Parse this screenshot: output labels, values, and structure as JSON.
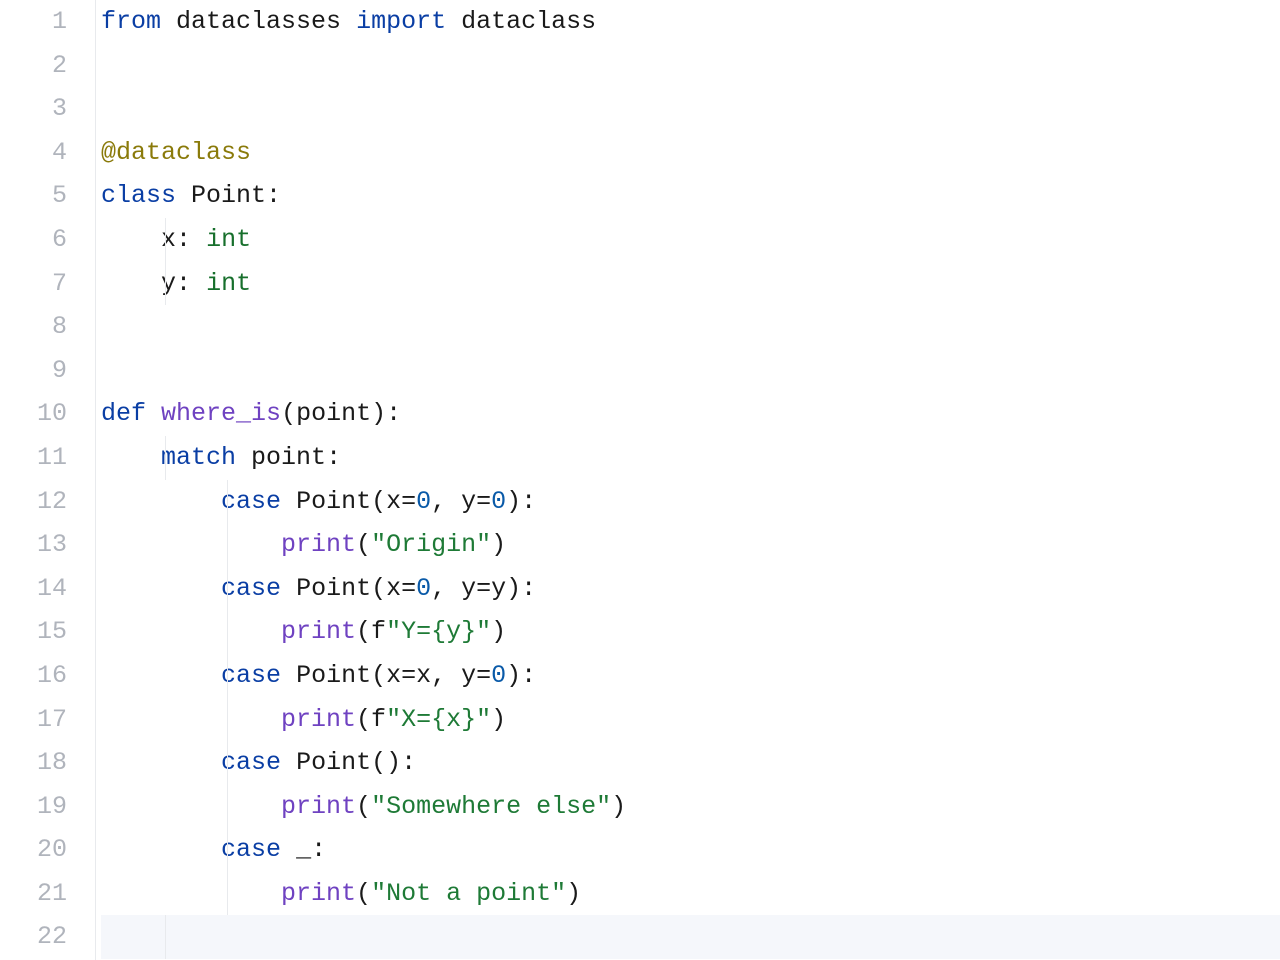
{
  "editor": {
    "line_numbers": [
      "1",
      "2",
      "3",
      "4",
      "5",
      "6",
      "7",
      "8",
      "9",
      "10",
      "11",
      "12",
      "13",
      "14",
      "15",
      "16",
      "17",
      "18",
      "19",
      "20",
      "21",
      "22"
    ],
    "current_line": 22,
    "lines": {
      "l1": {
        "kw_from": "from",
        "mod": "dataclasses",
        "kw_import": "import",
        "name": "dataclass"
      },
      "l4": {
        "decorator": "@dataclass"
      },
      "l5": {
        "kw_class": "class",
        "name": "Point",
        "colon": ":"
      },
      "l6": {
        "ident": "x",
        "colon": ":",
        "type": "int"
      },
      "l7": {
        "ident": "y",
        "colon": ":",
        "type": "int"
      },
      "l10": {
        "kw_def": "def",
        "fn": "where_is",
        "params": "(point):"
      },
      "l11": {
        "kw_match": "match",
        "subj": "point",
        "colon": ":"
      },
      "l12": {
        "kw_case": "case",
        "cls": "Point",
        "open": "(x=",
        "zero1": "0",
        "mid": ", y=",
        "zero2": "0",
        "close": "):"
      },
      "l13": {
        "fn": "print",
        "open": "(",
        "str": "\"Origin\"",
        "close": ")"
      },
      "l14": {
        "kw_case": "case",
        "cls": "Point",
        "open": "(x=",
        "zero": "0",
        "mid": ", y=y):",
        "dummy": ""
      },
      "l15": {
        "fn": "print",
        "open": "(f",
        "str": "\"Y={y}\"",
        "close": ")"
      },
      "l16": {
        "kw_case": "case",
        "cls": "Point",
        "open": "(x=x, y=",
        "zero": "0",
        "close": "):"
      },
      "l17": {
        "fn": "print",
        "open": "(f",
        "str": "\"X={x}\"",
        "close": ")"
      },
      "l18": {
        "kw_case": "case",
        "cls": "Point",
        "rest": "():"
      },
      "l19": {
        "fn": "print",
        "open": "(",
        "str": "\"Somewhere else\"",
        "close": ")"
      },
      "l20": {
        "kw_case": "case",
        "under": "_",
        "colon": ":"
      },
      "l21": {
        "fn": "print",
        "open": "(",
        "str": "\"Not a point\"",
        "close": ")"
      }
    }
  }
}
